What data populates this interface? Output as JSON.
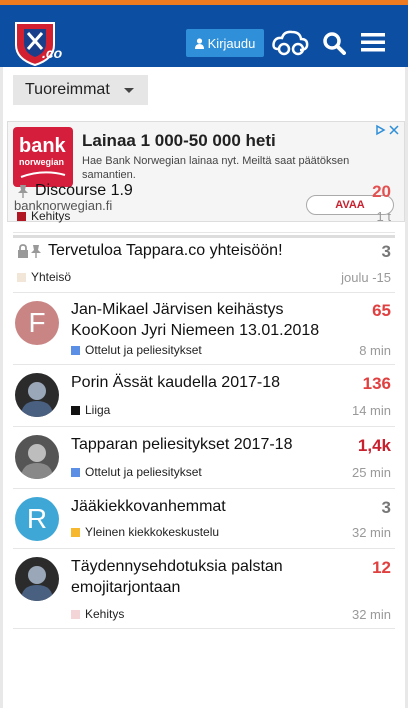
{
  "header": {
    "logo_text": ".co",
    "login_label": "Kirjaudu",
    "colors": {
      "bar": "#0b4ea2",
      "accent_line": "#ef7b21",
      "login_button": "#2f8fd8"
    }
  },
  "filter": {
    "selected": "Tuoreimmat"
  },
  "ad": {
    "logo_word": "bank",
    "logo_sub": "norwegian",
    "title": "Lainaa 1 000-50 000 heti",
    "description": "Hae Bank Norwegian lainaa nyt. Meiltä saat päätöksen samantien.",
    "url": "banknorwegian.fi",
    "button": "AVAA"
  },
  "topics": [
    {
      "title": "Discourse 1.9",
      "title2": "",
      "category": "Kehitys",
      "cat_color": "#b11623",
      "count": "20",
      "count_color": "#e45050",
      "age": "1 t",
      "icons": [
        "pin-icon"
      ],
      "avatar": "none"
    },
    {
      "title": "Tervetuloa Tappara.co yhteisöön!",
      "title2": "",
      "category": "Yhteisö",
      "cat_color": "#f2e6d9",
      "count": "3",
      "count_color": "#777777",
      "age": "joulu -15",
      "icons": [
        "lock-icon",
        "pin-icon"
      ],
      "avatar": "none"
    },
    {
      "title": "Jan-Mikael Järvisen keihästys",
      "title2": "KooKoon Jyri Niemeen 13.01.2018",
      "category": "Ottelut ja peliesitykset",
      "cat_color": "#5b8fe6",
      "count": "65",
      "count_color": "#e04040",
      "age": "8 min",
      "icons": [],
      "avatar": "F"
    },
    {
      "title": "Porin Ässät kaudella 2017-18",
      "title2": "",
      "category": "Liiga",
      "cat_color": "#111111",
      "count": "136",
      "count_color": "#e04040",
      "age": "14 min",
      "icons": [],
      "avatar": "photo1"
    },
    {
      "title": "Tapparan peliesitykset 2017-18",
      "title2": "",
      "category": "Ottelut ja peliesitykset",
      "cat_color": "#5b8fe6",
      "count": "1,4k",
      "count_color": "#c8202f",
      "age": "25 min",
      "icons": [],
      "avatar": "photo2"
    },
    {
      "title": "Jääkiekkovanhemmat",
      "title2": "",
      "category": "Yleinen kiekkokeskustelu",
      "cat_color": "#f5b82e",
      "count": "3",
      "count_color": "#777777",
      "age": "32 min",
      "icons": [],
      "avatar": "R"
    },
    {
      "title": "Täydennysehdotuksia palstan",
      "title2": "emojitarjontaan",
      "category": "Kehitys",
      "cat_color": "#f3d5d8",
      "count": "12",
      "count_color": "#e04040",
      "age": "32 min",
      "icons": [],
      "avatar": "photo1"
    }
  ]
}
